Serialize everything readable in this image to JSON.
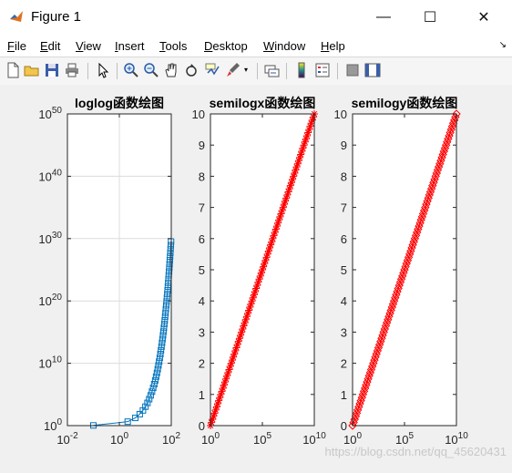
{
  "window": {
    "title": "Figure 1",
    "minimize_glyph": "—",
    "maximize_glyph": "☐",
    "close_glyph": "✕"
  },
  "menu": [
    {
      "label": "File",
      "accel": "F",
      "rest": "ile"
    },
    {
      "label": "Edit",
      "accel": "E",
      "rest": "dit"
    },
    {
      "label": "View",
      "accel": "V",
      "rest": "iew"
    },
    {
      "label": "Insert",
      "accel": "I",
      "rest": "nsert"
    },
    {
      "label": "Tools",
      "accel": "T",
      "rest": "ools"
    },
    {
      "label": "Desktop",
      "accel": "D",
      "rest": "esktop"
    },
    {
      "label": "Window",
      "accel": "W",
      "rest": "indow"
    },
    {
      "label": "Help",
      "accel": "H",
      "rest": "elp"
    }
  ],
  "toolbar": [
    "new-figure-icon",
    "open-file-icon",
    "save-icon",
    "print-icon",
    "edit-plot-icon",
    "zoom-in-icon",
    "zoom-out-icon",
    "pan-icon",
    "rotate-3d-icon",
    "data-cursor-icon",
    "brush-icon",
    "link-plot-icon",
    "insert-colorbar-icon",
    "insert-legend-icon",
    "hide-plot-tools-icon",
    "show-plot-tools-icon"
  ],
  "colors": {
    "loglog_line": "#0072bd",
    "semilog_marker": "#ff0000",
    "axes_bg": "#ffffff",
    "figure_bg": "#f0f0f0",
    "grid": "#dcdcdc"
  },
  "watermark": "https://blog.csdn.net/qq_45620431",
  "chart_data": [
    {
      "type": "line",
      "title": "loglog函数绘图",
      "marker": "square",
      "xscale": "log",
      "yscale": "log",
      "xlim": [
        0.01,
        100
      ],
      "ylim": [
        1,
        1e+50
      ],
      "x_ticks": [
        {
          "base": "10",
          "exp": "-2",
          "v": 0.01
        },
        {
          "base": "10",
          "exp": "0",
          "v": 1
        },
        {
          "base": "10",
          "exp": "2",
          "v": 100
        }
      ],
      "y_ticks": [
        {
          "base": "10",
          "exp": "0",
          "v": 1
        },
        {
          "base": "10",
          "exp": "10",
          "v": 10000000000.0
        },
        {
          "base": "10",
          "exp": "20",
          "v": 1e+20
        },
        {
          "base": "10",
          "exp": "30",
          "v": 1e+30
        },
        {
          "base": "10",
          "exp": "40",
          "v": 1e+40
        },
        {
          "base": "10",
          "exp": "50",
          "v": 1e+50
        }
      ],
      "grid": true,
      "function": "y = 2^x, x = 0.1:2:100"
    },
    {
      "type": "line",
      "title": "semilogx函数绘图",
      "marker": "asterisk",
      "xscale": "log",
      "yscale": "linear",
      "xlim": [
        1,
        10000000000.0
      ],
      "ylim": [
        0,
        10
      ],
      "x_ticks": [
        {
          "base": "10",
          "exp": "0",
          "v": 1
        },
        {
          "base": "10",
          "exp": "5",
          "v": 100000.0
        },
        {
          "base": "10",
          "exp": "10",
          "v": 10000000000.0
        }
      ],
      "y_ticks": [
        {
          "label": "0",
          "v": 0
        },
        {
          "label": "1",
          "v": 1
        },
        {
          "label": "2",
          "v": 2
        },
        {
          "label": "3",
          "v": 3
        },
        {
          "label": "4",
          "v": 4
        },
        {
          "label": "5",
          "v": 5
        },
        {
          "label": "6",
          "v": 6
        },
        {
          "label": "7",
          "v": 7
        },
        {
          "label": "8",
          "v": 8
        },
        {
          "label": "9",
          "v": 9
        },
        {
          "label": "10",
          "v": 10
        }
      ],
      "grid": false,
      "function": "x = 10^y, y = 0:0.1:10"
    },
    {
      "type": "line",
      "title": "semilogy函数绘图",
      "marker": "diamond",
      "xscale": "log",
      "yscale": "linear",
      "xlim": [
        1,
        10000000000.0
      ],
      "ylim": [
        0,
        10
      ],
      "x_ticks": [
        {
          "base": "10",
          "exp": "0",
          "v": 1
        },
        {
          "base": "10",
          "exp": "5",
          "v": 100000.0
        },
        {
          "base": "10",
          "exp": "10",
          "v": 10000000000.0
        }
      ],
      "y_ticks": [
        {
          "label": "0",
          "v": 0
        },
        {
          "label": "1",
          "v": 1
        },
        {
          "label": "2",
          "v": 2
        },
        {
          "label": "3",
          "v": 3
        },
        {
          "label": "4",
          "v": 4
        },
        {
          "label": "5",
          "v": 5
        },
        {
          "label": "6",
          "v": 6
        },
        {
          "label": "7",
          "v": 7
        },
        {
          "label": "8",
          "v": 8
        },
        {
          "label": "9",
          "v": 9
        },
        {
          "label": "10",
          "v": 10
        }
      ],
      "grid": false,
      "function": "x = 10^y, y = 0:0.1:10"
    }
  ]
}
